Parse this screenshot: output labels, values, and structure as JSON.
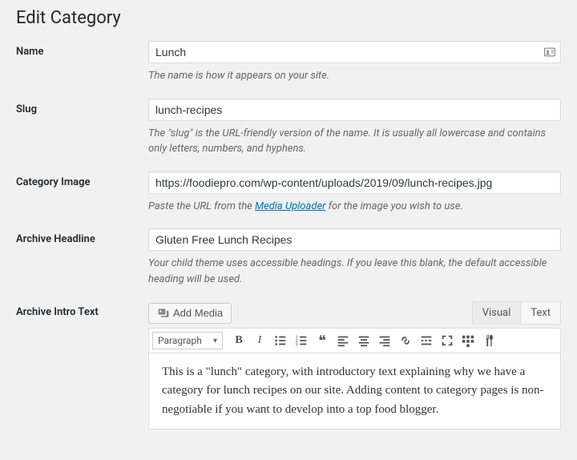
{
  "page_title": "Edit Category",
  "fields": {
    "name": {
      "label": "Name",
      "value": "Lunch",
      "description": "The name is how it appears on your site."
    },
    "slug": {
      "label": "Slug",
      "value": "lunch-recipes",
      "description": "The \"slug\" is the URL-friendly version of the name. It is usually all lowercase and contains only letters, numbers, and hyphens."
    },
    "category_image": {
      "label": "Category Image",
      "value": "https://foodiepro.com/wp-content/uploads/2019/09/lunch-recipes.jpg",
      "desc_prefix": "Paste the URL from the ",
      "desc_link": "Media Uploader",
      "desc_suffix": " for the image you wish to use."
    },
    "archive_headline": {
      "label": "Archive Headline",
      "value": "Gluten Free Lunch Recipes",
      "description": "Your child theme uses accessible headings. If you leave this blank, the default accessible heading will be used."
    },
    "archive_intro": {
      "label": "Archive Intro Text",
      "add_media": "Add Media",
      "tab_visual": "Visual",
      "tab_text": "Text",
      "format_selected": "Paragraph",
      "content": "This is a \"lunch\" category, with introductory text explaining why we have a category for lunch recipes on our site. Adding content to category pages is non-negotiable if you want to develop into a top food blogger."
    }
  }
}
